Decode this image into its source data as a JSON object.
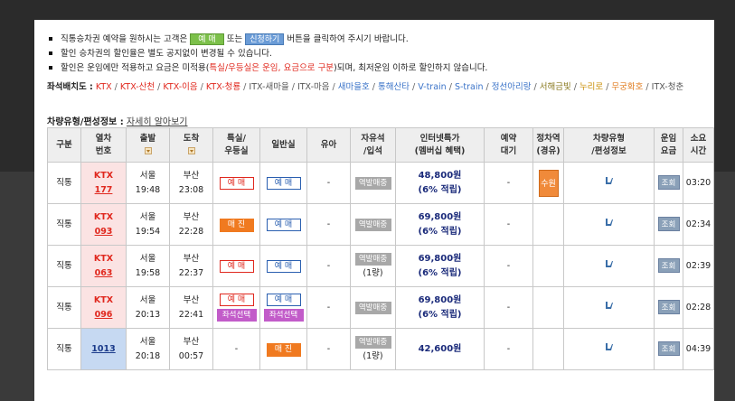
{
  "notices": [
    {
      "pre": "직통승차권 예약을 원하시는 고객은",
      "btn1": "예 매",
      "mid": "또는",
      "btn2": "신청하기",
      "post": "버튼을 클릭하여 주시기 바랍니다."
    },
    {
      "text": "할인 승차권의 할인율은 별도 공지없이 변경될 수 있습니다."
    },
    {
      "pre": "할인은 운임에만 적용하고 요금은 미적용(",
      "red": "특실/우등실은 운임, 요금으로 구분",
      "post": ")되며, 최저운임 이하로 할인하지 않습니다."
    }
  ],
  "seat_map": {
    "label": "좌석배치도 :",
    "items": [
      {
        "text": "KTX",
        "color": "red"
      },
      {
        "text": "KTX-산천",
        "color": "red"
      },
      {
        "text": "KTX-이음",
        "color": "red"
      },
      {
        "text": "KTX-청룡",
        "color": "red"
      },
      {
        "text": "ITX-새마을",
        "color": "gray"
      },
      {
        "text": "ITX-마음",
        "color": "gray"
      },
      {
        "text": "새마을호",
        "color": "blue"
      },
      {
        "text": "통해산타",
        "color": "blue"
      },
      {
        "text": "V-train",
        "color": "blue"
      },
      {
        "text": "S-train",
        "color": "blue"
      },
      {
        "text": "정선아리랑",
        "color": "blue"
      },
      {
        "text": "서해금빛",
        "color": "olive"
      },
      {
        "text": "누리로",
        "color": "gold"
      },
      {
        "text": "무궁화호",
        "color": "orange"
      },
      {
        "text": "ITX-청춘",
        "color": "gray"
      }
    ]
  },
  "train_info": {
    "label": "차량유형/편성정보 :",
    "link": "자세히 알아보기"
  },
  "table": {
    "headers": {
      "type": "구분",
      "train_no_1": "열차",
      "train_no_2": "번호",
      "dep": "출발",
      "arr": "도착",
      "first_1": "특실/",
      "first_2": "우등실",
      "general": "일반실",
      "infant": "유아",
      "free_1": "자유석",
      "free_2": "/입석",
      "price_1": "인터넷특가",
      "price_2": "(멤버십 혜택)",
      "wait_1": "예약",
      "wait_2": "대기",
      "transfer_1": "정차역",
      "transfer_2": "(경유)",
      "car_1": "차량유형",
      "car_2": "/편성정보",
      "fare_1": "운임",
      "fare_2": "요금",
      "dur_1": "소요",
      "dur_2": "시간"
    },
    "rows": [
      {
        "type": "직통",
        "train_name": "KTX",
        "train_num": "177",
        "dep_station": "서울",
        "dep_time": "19:48",
        "arr_station": "부산",
        "arr_time": "23:08",
        "first": "예 매",
        "general": "예 매",
        "infant": "-",
        "free": "역발매중",
        "free_sub": "",
        "price": "48,800원",
        "discount": "(6% 적립)",
        "wait": "-",
        "transfer": "수원",
        "fare_btn": "조회",
        "duration": "03:20"
      },
      {
        "type": "직통",
        "train_name": "KTX",
        "train_num": "093",
        "dep_station": "서울",
        "dep_time": "19:54",
        "arr_station": "부산",
        "arr_time": "22:28",
        "first": "매 진",
        "general": "예 매",
        "infant": "-",
        "free": "역발매중",
        "free_sub": "",
        "price": "69,800원",
        "discount": "(6% 적립)",
        "wait": "-",
        "transfer": "",
        "fare_btn": "조회",
        "duration": "02:34"
      },
      {
        "type": "직통",
        "train_name": "KTX",
        "train_num": "063",
        "dep_station": "서울",
        "dep_time": "19:58",
        "arr_station": "부산",
        "arr_time": "22:37",
        "first": "예 매",
        "general": "예 매",
        "infant": "-",
        "free": "역발매중",
        "free_sub": "(1량)",
        "price": "69,800원",
        "discount": "(6% 적립)",
        "wait": "-",
        "transfer": "",
        "fare_btn": "조회",
        "duration": "02:39"
      },
      {
        "type": "직통",
        "train_name": "KTX",
        "train_num": "096",
        "dep_station": "서울",
        "dep_time": "20:13",
        "arr_station": "부산",
        "arr_time": "22:41",
        "first": "예 매",
        "first_seat": "좌석선택",
        "general": "예 매",
        "general_seat": "좌석선택",
        "infant": "-",
        "free": "역발매중",
        "free_sub": "",
        "price": "69,800원",
        "discount": "(6% 적립)",
        "wait": "-",
        "transfer": "",
        "fare_btn": "조회",
        "duration": "02:28"
      },
      {
        "type": "직통",
        "train_name": "",
        "train_num": "1013",
        "dep_station": "서울",
        "dep_time": "20:18",
        "arr_station": "부산",
        "arr_time": "00:57",
        "first": "-",
        "general": "매 진",
        "infant": "-",
        "free": "역발매중",
        "free_sub": "(1량)",
        "price": "42,600원",
        "discount": "",
        "wait": "-",
        "transfer": "",
        "fare_btn": "조회",
        "duration": "04:39"
      }
    ]
  },
  "colors": {
    "ktx_row_bg": "#fbe3e3",
    "itx_row_bg": "#c6d9f2",
    "accent_red": "#e0281e",
    "wait_orange": "#f07a20",
    "seat_purple": "#c25cc9"
  }
}
